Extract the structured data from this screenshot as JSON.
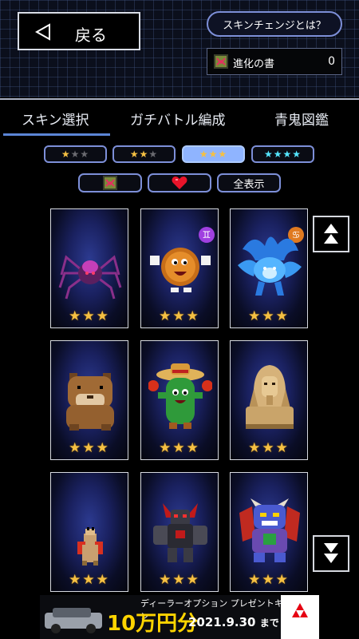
{
  "header": {
    "back_label": "戻る",
    "skin_change_label": "スキンチェンジとは？",
    "book": {
      "name": "進化の書",
      "count": "0"
    }
  },
  "tabs": [
    {
      "label": "スキン選択",
      "active": true
    },
    {
      "label": "ガチバトル編成",
      "active": false
    },
    {
      "label": "青鬼図鑑",
      "active": false
    }
  ],
  "star_filters": [
    {
      "gold": "★",
      "grey": "★★",
      "active": false
    },
    {
      "gold": "★★",
      "grey": "★",
      "active": false
    },
    {
      "gold": "★★★",
      "grey": "",
      "active": true
    },
    {
      "cyan": "★★★★",
      "active": false
    }
  ],
  "filters2": {
    "show_all_label": "全表示"
  },
  "cards": [
    {
      "name": "spider",
      "stars": "★★★"
    },
    {
      "name": "coin",
      "stars": "★★★",
      "badge": "♊",
      "badge_color": "#a040e0"
    },
    {
      "name": "blue-beast",
      "stars": "★★★",
      "badge": "♋",
      "badge_color": "#e07a20"
    },
    {
      "name": "capybara",
      "stars": "★★★"
    },
    {
      "name": "cactus",
      "stars": "★★★"
    },
    {
      "name": "sphinx",
      "stars": "★★★"
    },
    {
      "name": "alpaca",
      "stars": "★★★"
    },
    {
      "name": "robot",
      "stars": "★★★"
    },
    {
      "name": "demon",
      "stars": "★★★"
    }
  ],
  "ad": {
    "line1": "ディーラーオプション プレゼントキャンペーン",
    "money": "10万円分",
    "date": "2021.9.30",
    "date_suffix": "まで"
  }
}
